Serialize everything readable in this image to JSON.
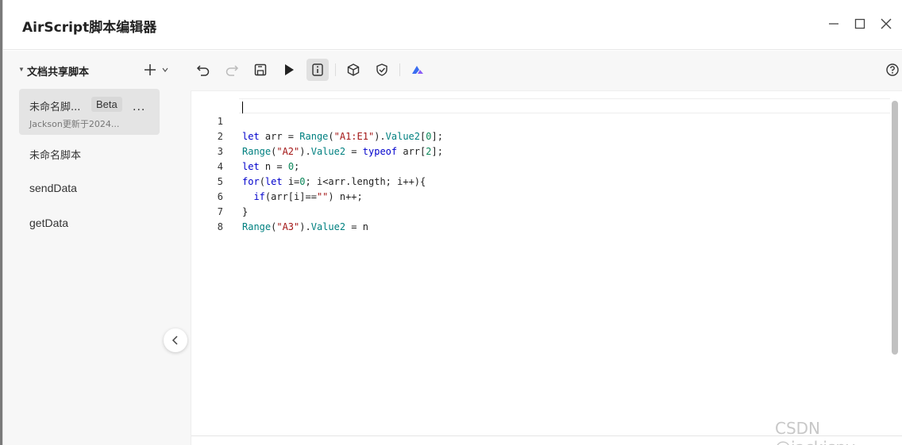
{
  "window": {
    "title": "AirScript脚本编辑器"
  },
  "sidebar": {
    "section_title": "文档共享脚本",
    "add_label": "+",
    "items": [
      {
        "name": "未命名脚...",
        "badge": "Beta",
        "subtitle": "Jackson更新于2024...",
        "more": "...",
        "active": true
      },
      {
        "name": "未命名脚本"
      },
      {
        "name": "sendData"
      },
      {
        "name": "getData"
      }
    ]
  },
  "toolbar": {
    "buttons": [
      "undo-icon",
      "redo-icon",
      "save-icon",
      "run-icon",
      "info-icon",
      "cube-icon",
      "shield-icon",
      "airscript-logo-icon"
    ],
    "help": "help-icon"
  },
  "editor": {
    "line_numbers": [
      "1",
      "2",
      "3",
      "4",
      "5",
      "6",
      "7",
      "8"
    ],
    "lines": [
      "let arr = Range(\"A1:E1\").Value2[0];",
      "Range(\"A2\").Value2 = typeof arr[2];",
      "let n = 0;",
      "for(let i=0; i<arr.length; i++){",
      "  if(arr[i]==\"\") n++;",
      "}",
      "Range(\"A3\").Value2 = n",
      ""
    ]
  },
  "watermark": "CSDN @jackispy",
  "colors": {
    "keyword": "#0000cc",
    "function": "#008080",
    "string": "#a31515",
    "number": "#098658"
  }
}
